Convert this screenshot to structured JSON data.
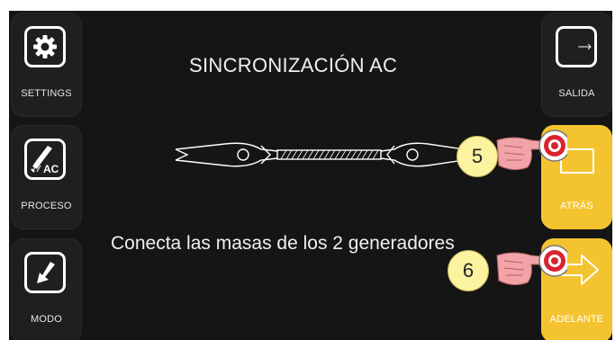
{
  "screen": {
    "title": "SINCRONIZACIÓN AC",
    "instruction": "Conecta las masas de los 2 generadores"
  },
  "left_menu": {
    "settings": {
      "label": "SETTINGS",
      "icon": "gear-icon"
    },
    "proceso": {
      "label": "PROCESO",
      "icon": "ac-torch-icon",
      "badge": "AC"
    },
    "modo": {
      "label": "MODO",
      "icon": "arrow-down-left-icon"
    }
  },
  "right_menu": {
    "salida": {
      "label": "SALIDA",
      "icon": "exit-arrow-icon"
    },
    "atras": {
      "label": "ATRÁS",
      "icon": "back-icon"
    },
    "adelante": {
      "label": "ADELANTE",
      "icon": "forward-arrow-icon"
    }
  },
  "steps": {
    "step_back": "5",
    "step_forward": "6"
  },
  "colors": {
    "background": "#151515",
    "button": "#1f1f1f",
    "accent_yellow": "#f4c430",
    "badge_yellow": "#fbf3a0",
    "hand_pink": "#f2a3a8",
    "dial_red": "#d9232f"
  }
}
